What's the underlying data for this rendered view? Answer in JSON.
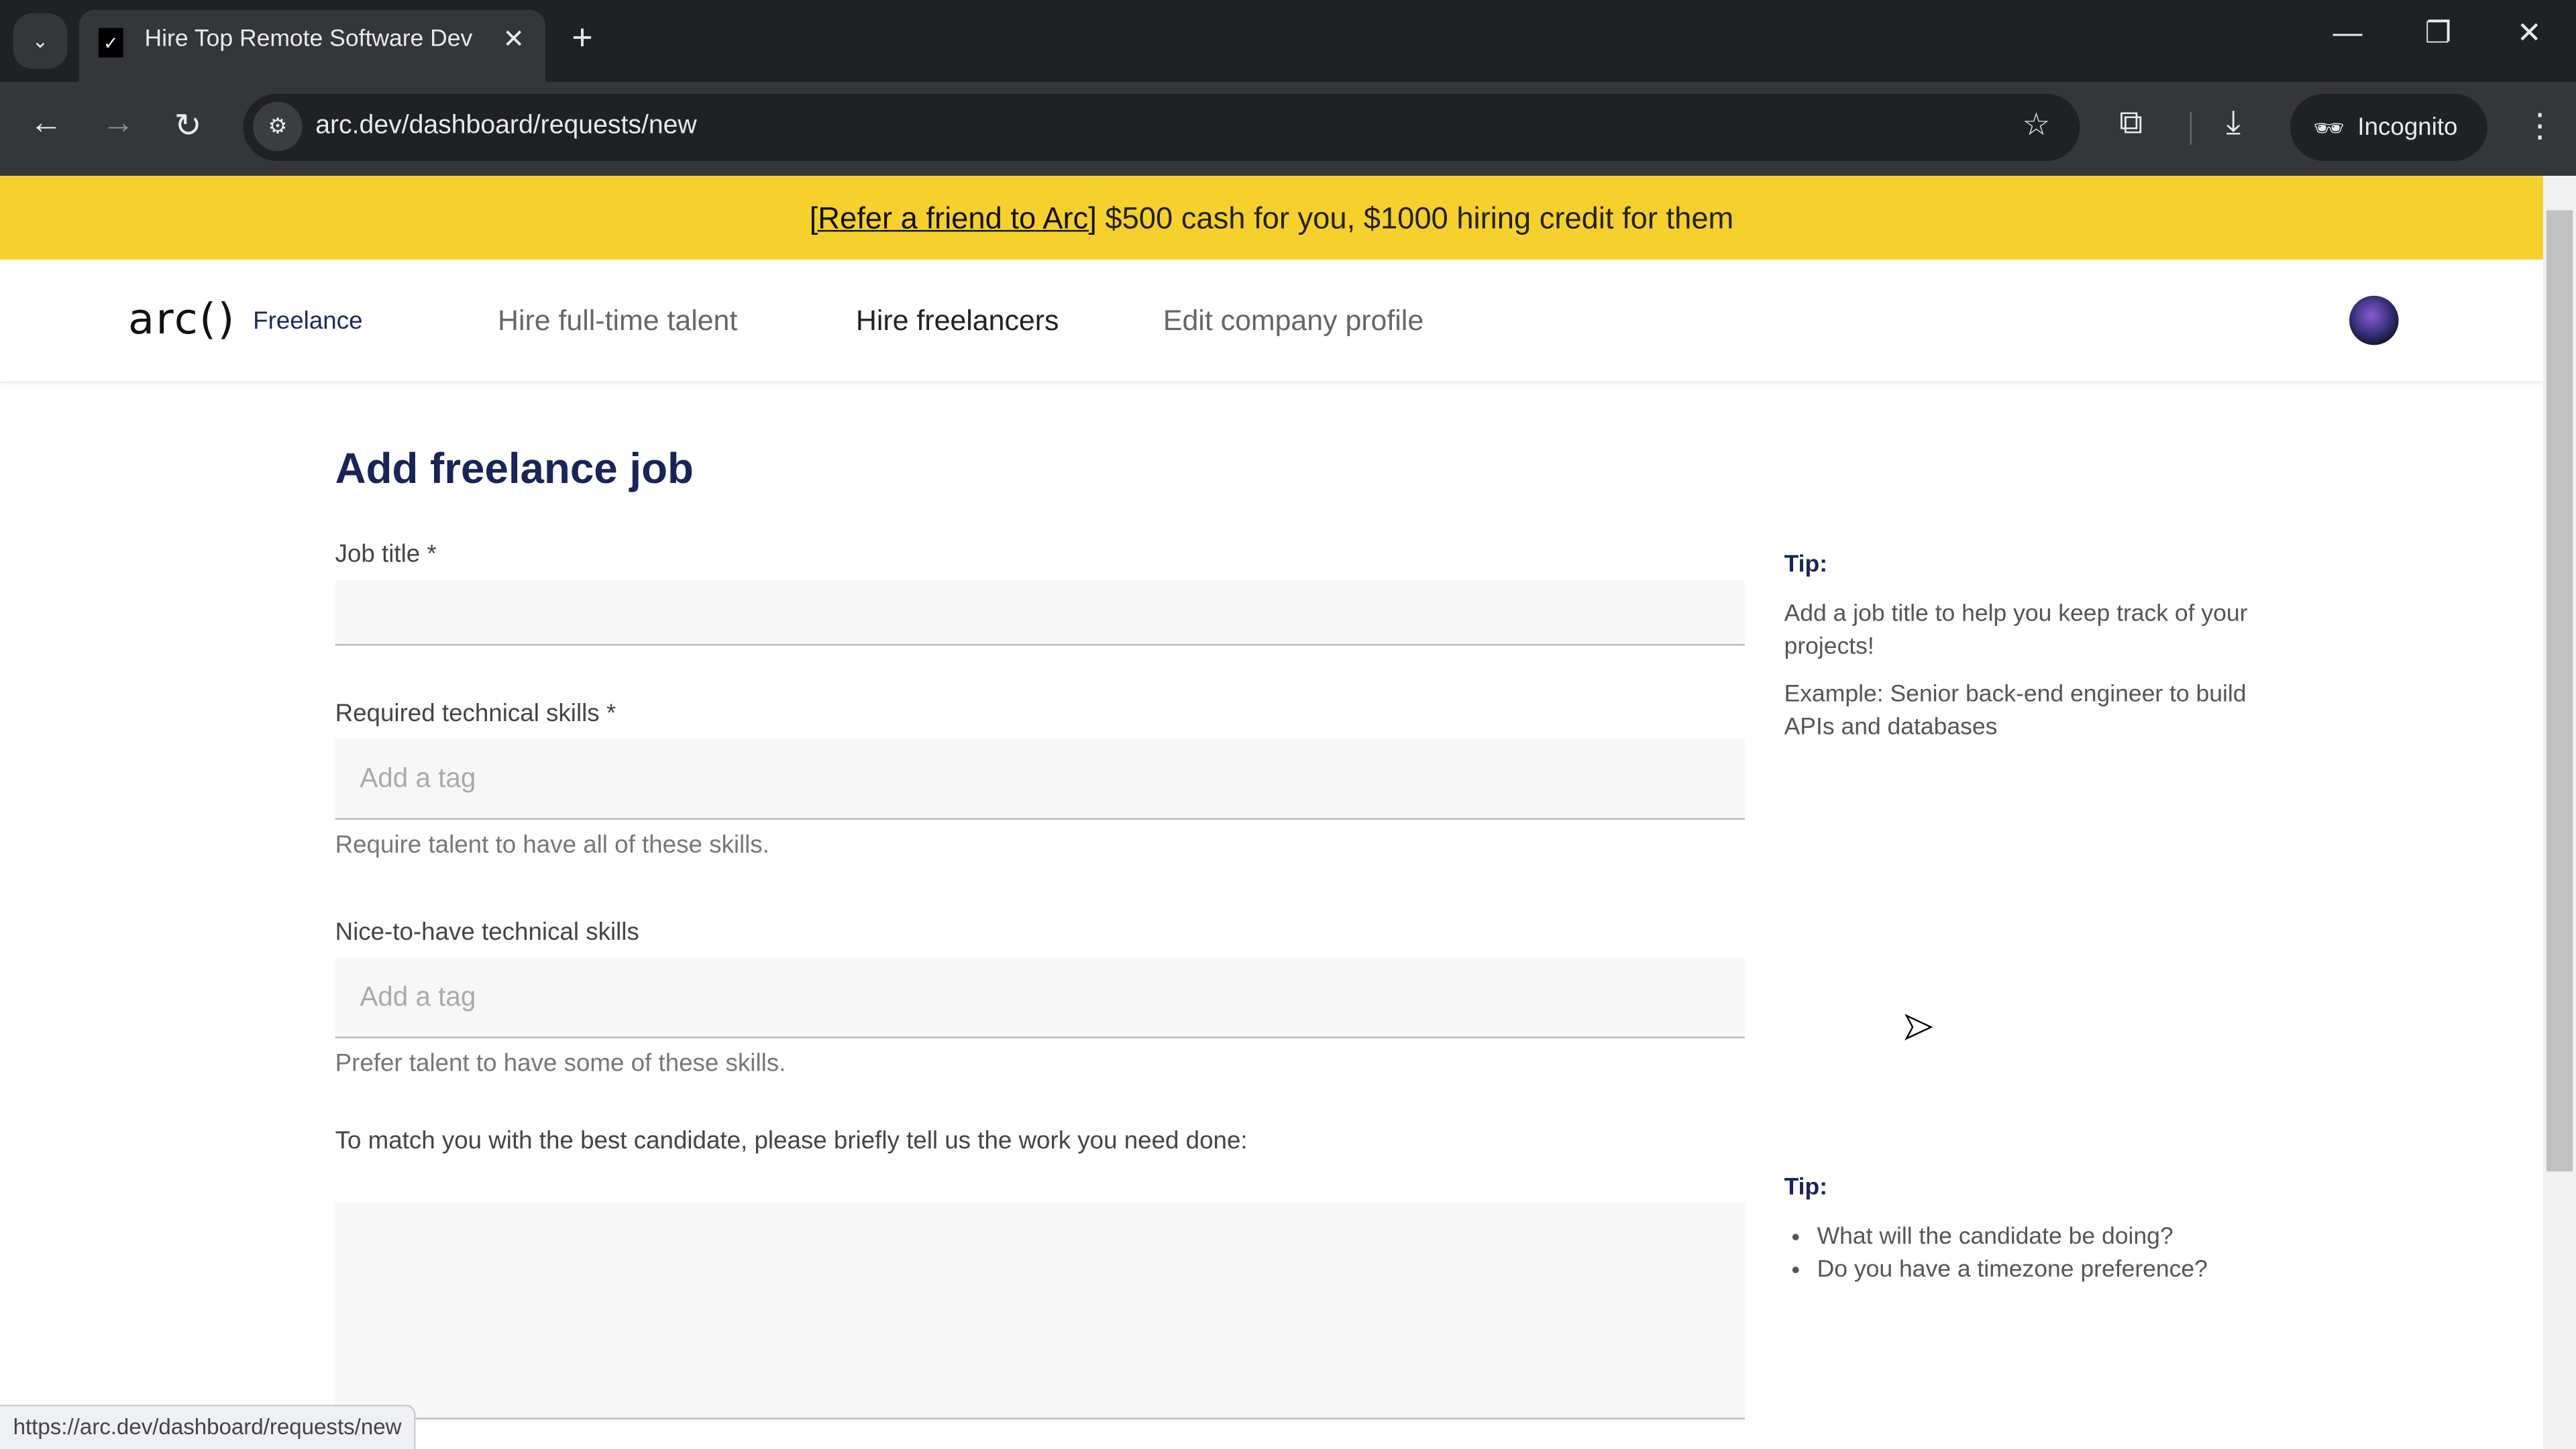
{
  "browser": {
    "tab_title": "Hire Top Remote Software Dev",
    "url": "arc.dev/dashboard/requests/new",
    "profile_label": "Incognito",
    "status_url": "https://arc.dev/dashboard/requests/new"
  },
  "banner": {
    "link_text": "[Refer a friend to Arc]",
    "text": " $500 cash for you, $1000 hiring credit for them",
    "color": "#f6d02e"
  },
  "header": {
    "logo": "arc()",
    "logo_sub": "Freelance",
    "nav": [
      "Hire full-time talent",
      "Hire freelancers",
      "Edit company profile"
    ]
  },
  "form": {
    "title": "Add freelance job",
    "job_title": {
      "label": "Job title *",
      "value": ""
    },
    "required_skills": {
      "label": "Required technical skills *",
      "placeholder": "Add a tag",
      "help": "Require talent to have all of these skills."
    },
    "nice_skills": {
      "label": "Nice-to-have technical skills",
      "placeholder": "Add a tag",
      "help": "Prefer talent to have some of these skills."
    },
    "description": {
      "label": "To match you with the best candidate, please briefly tell us the work you need done:",
      "value": ""
    }
  },
  "tips": [
    {
      "heading": "Tip:",
      "lines": [
        "Add a job title to help you keep track of your projects!",
        "Example: Senior back-end engineer to build APIs and databases"
      ]
    },
    {
      "heading": "Tip:",
      "bullets": [
        "What will the candidate be doing?",
        "Do you have a timezone preference?"
      ]
    }
  ]
}
